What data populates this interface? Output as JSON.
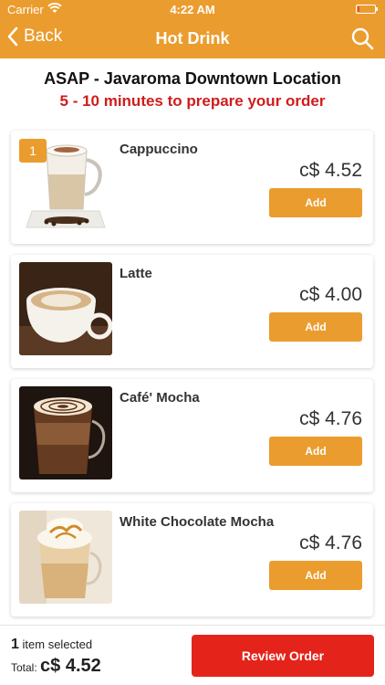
{
  "status_bar": {
    "carrier": "Carrier",
    "time": "4:22 AM",
    "battery_level": 0.1
  },
  "nav": {
    "back_label": "Back",
    "title": "Hot Drink"
  },
  "header": {
    "location": "ASAP - Javaroma Downtown Location",
    "prep_time": "5 - 10 minutes to prepare your order"
  },
  "products": [
    {
      "name": "Cappuccino",
      "price": "c$ 4.52",
      "add_label": "Add",
      "quantity": "1"
    },
    {
      "name": "Latte",
      "price": "c$ 4.00",
      "add_label": "Add"
    },
    {
      "name": "Café' Mocha",
      "price": "c$ 4.76",
      "add_label": "Add"
    },
    {
      "name": "White Chocolate Mocha",
      "price": "c$ 4.76",
      "add_label": "Add"
    }
  ],
  "footer": {
    "item_count": "1",
    "item_selected_text": "item selected",
    "total_label": "Total:",
    "total_amount": "c$ 4.52",
    "review_label": "Review Order"
  },
  "colors": {
    "brand": "#eb9c2e",
    "accent_red": "#d01c1c",
    "review_button": "#e4241b"
  },
  "icons": {
    "back": "chevron-left-icon",
    "search": "search-icon",
    "wifi": "wifi-icon",
    "battery": "battery-icon"
  }
}
